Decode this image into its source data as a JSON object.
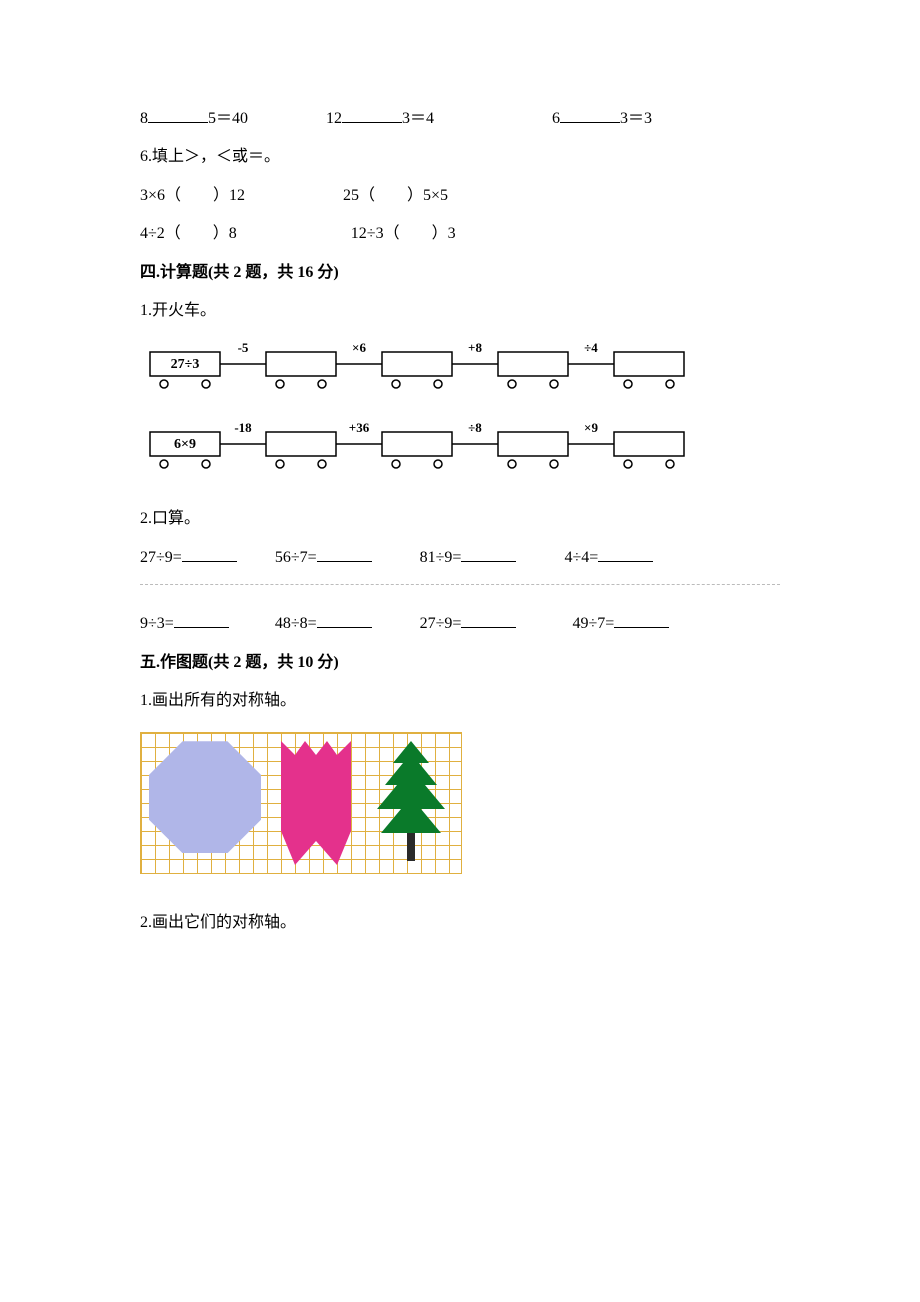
{
  "q5_row": {
    "a_left": "8",
    "a_right": "5＝40",
    "b_left": "12",
    "b_right": "3＝4",
    "c_left": "6",
    "c_right": "3＝3"
  },
  "q6": {
    "prompt": "6.填上＞，＜或＝。",
    "r1a": "3×6（　　）12",
    "r1b": "25（　　）5×5",
    "r2a": "4÷2（　　）8",
    "r2b": "12÷3（　　）3"
  },
  "s4": {
    "heading": "四.计算题(共 2 题，共 16 分)",
    "q1": "1.开火车。",
    "train1": {
      "start": "27÷3",
      "ops": [
        "-5",
        "×6",
        "+8",
        "÷4"
      ]
    },
    "train2": {
      "start": "6×9",
      "ops": [
        "-18",
        "+36",
        "÷8",
        "×9"
      ]
    },
    "q2": "2.口算。",
    "calc_row1": [
      "27÷9=",
      "56÷7=",
      "81÷9=",
      "4÷4="
    ],
    "calc_row2": [
      "9÷3=",
      "48÷8=",
      "27÷9=",
      "49÷7="
    ]
  },
  "s5": {
    "heading": "五.作图题(共 2 题，共 10 分)",
    "q1": "1.画出所有的对称轴。",
    "q2": "2.画出它们的对称轴。"
  }
}
